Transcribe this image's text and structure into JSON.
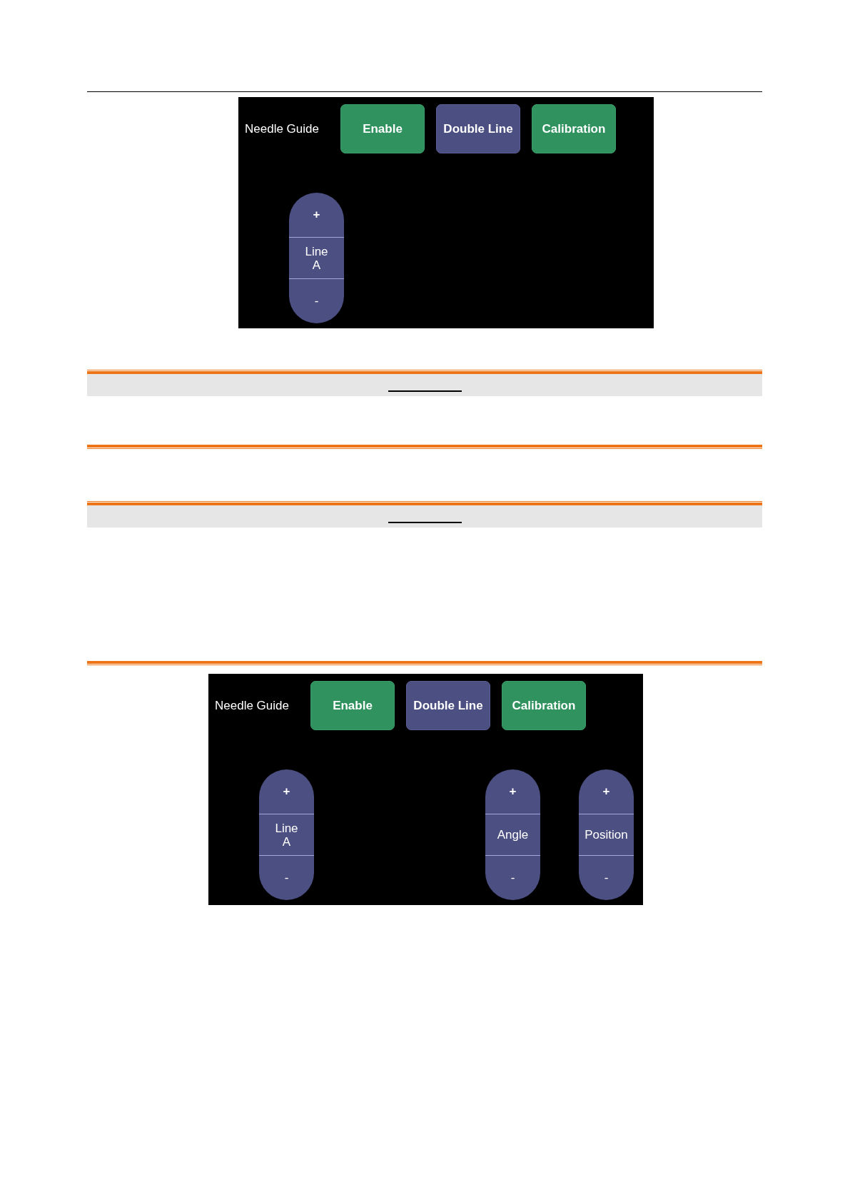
{
  "content": [
    {
      "kind": "screen",
      "title": "Needle Guide",
      "buttons": [
        {
          "label": "Enable",
          "on": true
        },
        {
          "label": "Double Line",
          "on": false
        },
        {
          "label": "Calibration",
          "on": true
        }
      ],
      "steppers": [
        {
          "increment": "+",
          "label": "Line\nA",
          "decrement": "-"
        }
      ]
    },
    {
      "kind": "notice_box"
    },
    {
      "kind": "notice_box"
    },
    {
      "kind": "screen",
      "title": "Needle Guide",
      "buttons": [
        {
          "label": "Enable",
          "on": true
        },
        {
          "label": "Double Line",
          "on": false
        },
        {
          "label": "Calibration",
          "on": true
        }
      ],
      "steppers": [
        {
          "increment": "+",
          "label": "Line\nA",
          "decrement": "-"
        },
        {
          "increment": "+",
          "label": "Angle",
          "decrement": "-"
        },
        {
          "increment": "+",
          "label": "Position",
          "decrement": "-"
        }
      ]
    }
  ]
}
